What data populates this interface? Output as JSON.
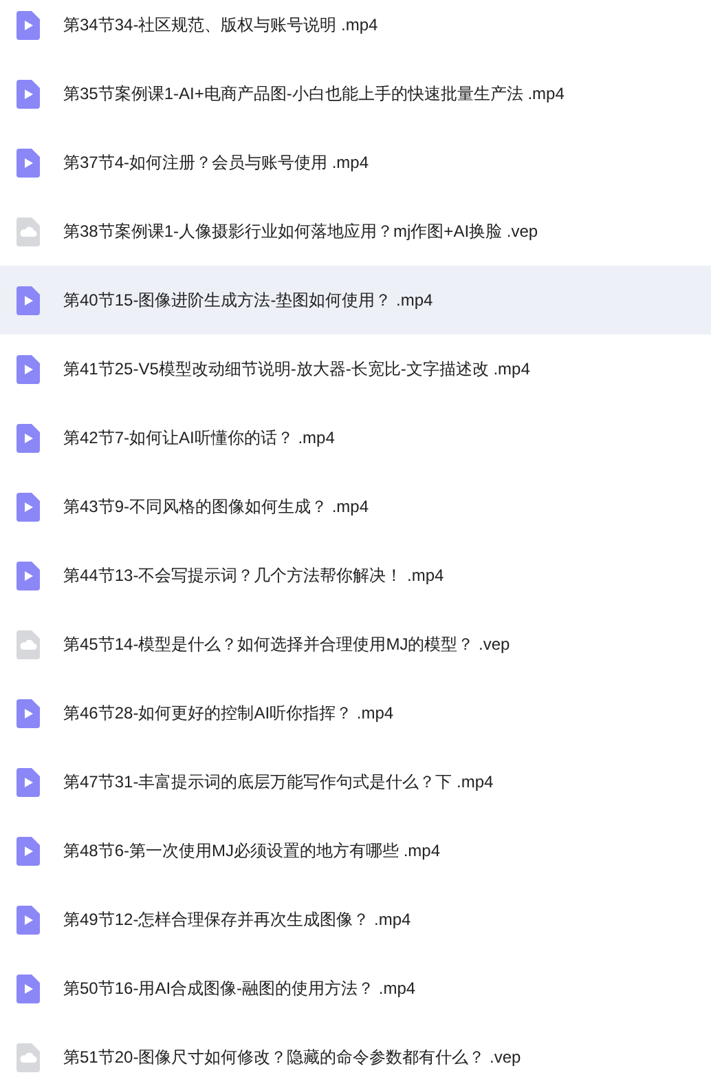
{
  "files": [
    {
      "name": "第34节34-社区规范、版权与账号说明 .mp4",
      "kind": "video",
      "selected": false
    },
    {
      "name": "第35节案例课1-AI+电商产品图-小白也能上手的快速批量生产法 .mp4",
      "kind": "video",
      "selected": false
    },
    {
      "name": "第37节4-如何注册？会员与账号使用 .mp4",
      "kind": "video",
      "selected": false
    },
    {
      "name": "第38节案例课1-人像摄影行业如何落地应用？mj作图+AI换脸 .vep",
      "kind": "cloud",
      "selected": false
    },
    {
      "name": "第40节15-图像进阶生成方法-垫图如何使用？ .mp4",
      "kind": "video",
      "selected": true
    },
    {
      "name": "第41节25-V5模型改动细节说明-放大器-长宽比-文字描述改 .mp4",
      "kind": "video",
      "selected": false
    },
    {
      "name": "第42节7-如何让AI听懂你的话？ .mp4",
      "kind": "video",
      "selected": false
    },
    {
      "name": "第43节9-不同风格的图像如何生成？ .mp4",
      "kind": "video",
      "selected": false
    },
    {
      "name": "第44节13-不会写提示词？几个方法帮你解决！ .mp4",
      "kind": "video",
      "selected": false
    },
    {
      "name": "第45节14-模型是什么？如何选择并合理使用MJ的模型？ .vep",
      "kind": "cloud",
      "selected": false
    },
    {
      "name": "第46节28-如何更好的控制AI听你指挥？ .mp4",
      "kind": "video",
      "selected": false
    },
    {
      "name": "第47节31-丰富提示词的底层万能写作句式是什么？下 .mp4",
      "kind": "video",
      "selected": false
    },
    {
      "name": "第48节6-第一次使用MJ必须设置的地方有哪些 .mp4",
      "kind": "video",
      "selected": false
    },
    {
      "name": "第49节12-怎样合理保存并再次生成图像？ .mp4",
      "kind": "video",
      "selected": false
    },
    {
      "name": "第50节16-用AI合成图像-融图的使用方法？ .mp4",
      "kind": "video",
      "selected": false
    },
    {
      "name": "第51节20-图像尺寸如何修改？隐藏的命令参数都有什么？ .vep",
      "kind": "cloud",
      "selected": false
    }
  ]
}
